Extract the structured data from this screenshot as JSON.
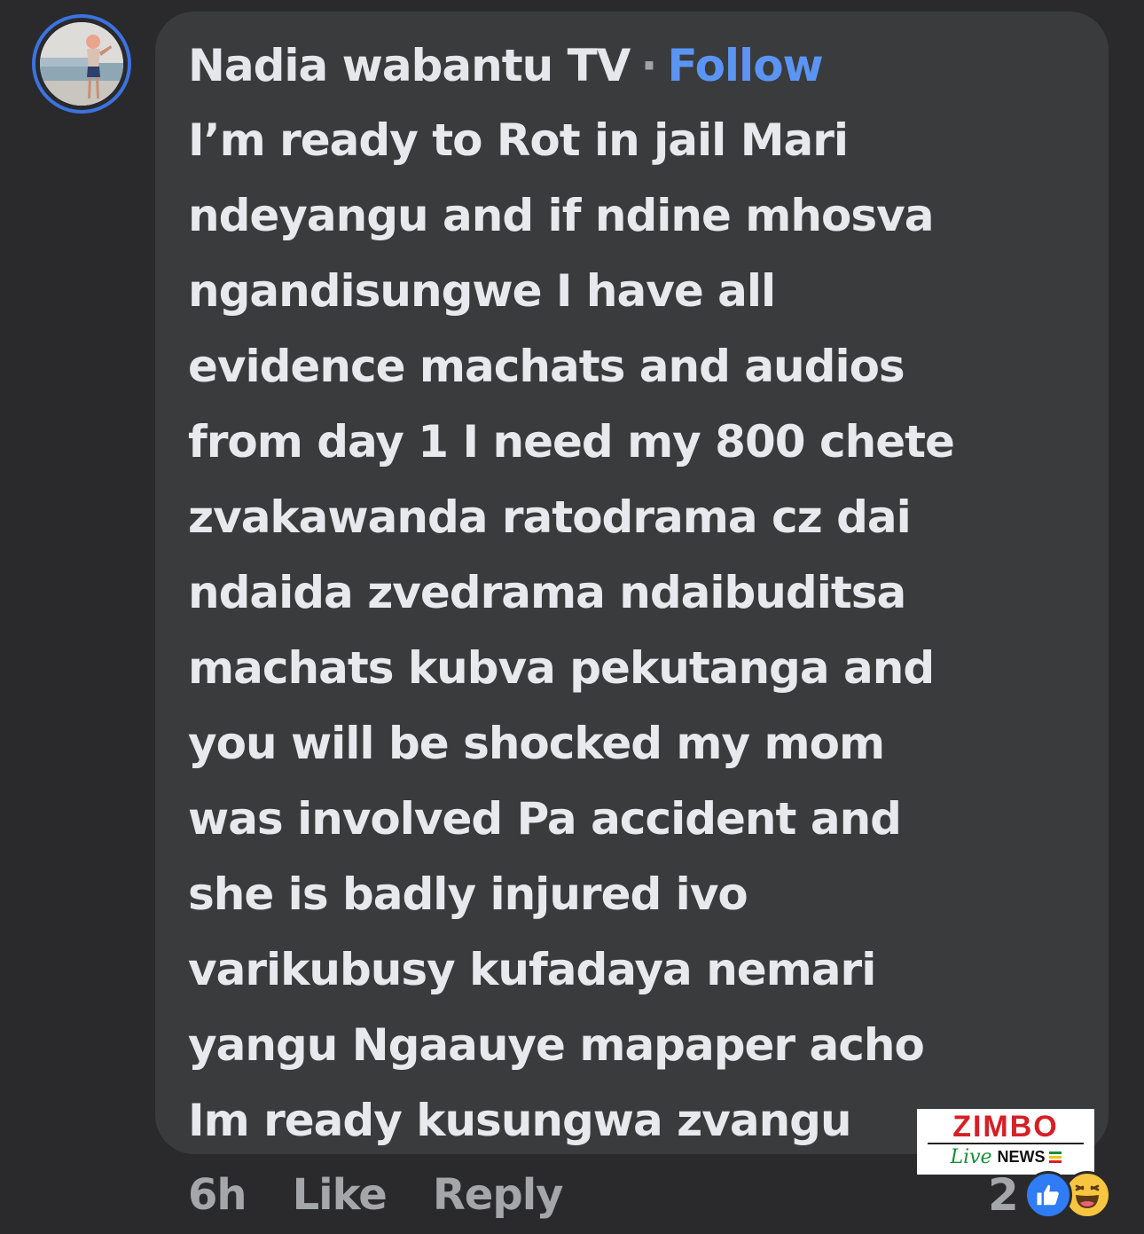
{
  "comment": {
    "author": "Nadia wabantu TV",
    "separator": "·",
    "follow_label": "Follow",
    "text": "I’m ready to Rot in jail Mari\nndeyangu and if ndine mhosva\nngandisungwe I have all\nevidence machats and audios\nfrom day 1 I need my 800 chete\nzvakawanda ratodrama cz dai\nndaida zvedrama ndaibuditsa\nmachats kubva pekutanga and\nyou will be shocked my mom\nwas involved Pa accident and\nshe is badly injured ivo\nvarikubusy kufadaya nemari\nyangu Ngaauye mapaper acho\nIm ready kusungwa zvangu"
  },
  "actions": {
    "time": "6h",
    "like_label": "Like",
    "reply_label": "Reply"
  },
  "reactions": {
    "count": "2",
    "icons": [
      "like-icon",
      "haha-icon"
    ]
  },
  "watermark": {
    "brand": "ZIMBO",
    "live": "Live",
    "news": "NEWS"
  },
  "colors": {
    "background": "#2a2a2c",
    "bubble": "#3a3b3d",
    "follow": "#5b95f4",
    "avatar_ring": "#3b73e0",
    "like_reaction": "#2f7cf6",
    "haha_reaction": "#f7c53f",
    "watermark_red": "#d61f26",
    "watermark_green": "#1a8d3a"
  }
}
